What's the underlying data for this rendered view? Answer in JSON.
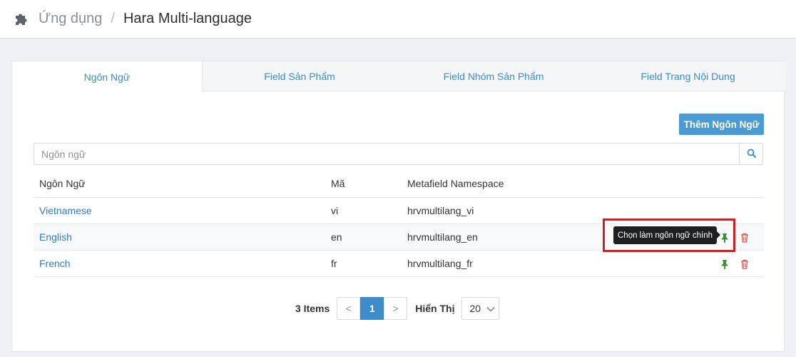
{
  "header": {
    "breadcrumb_parent": "Ứng dụng",
    "separator": "/",
    "title": "Hara Multi-language",
    "app_icon": "puzzle-icon"
  },
  "tabs": [
    {
      "label": "Ngôn Ngữ",
      "active": true
    },
    {
      "label": "Field Sản Phẩm",
      "active": false
    },
    {
      "label": "Field Nhóm Sản Phẩm",
      "active": false
    },
    {
      "label": "Field Trang Nội Dung",
      "active": false
    }
  ],
  "toolbar": {
    "add_label": "Thêm Ngôn Ngữ"
  },
  "search": {
    "placeholder": "Ngôn ngữ",
    "value": "",
    "icon": "search-icon"
  },
  "table": {
    "columns": [
      "Ngôn Ngữ",
      "Mã",
      "Metafield Namespace",
      ""
    ],
    "rows": [
      {
        "name": "Vietnamese",
        "code": "vi",
        "namespace": "hrvmultilang_vi",
        "actions": false
      },
      {
        "name": "English",
        "code": "en",
        "namespace": "hrvmultilang_en",
        "actions": true
      },
      {
        "name": "French",
        "code": "fr",
        "namespace": "hrvmultilang_fr",
        "actions": true
      }
    ]
  },
  "tooltip": {
    "text": "Chọn làm ngôn ngữ chính"
  },
  "pagination": {
    "items_text": "3 Items",
    "prev": "<",
    "current_page": "1",
    "next": ">",
    "show_label": "Hiển Thị",
    "per_page": "20"
  },
  "colors": {
    "accent": "#3b8cc9",
    "button": "#4a9ad4",
    "pin_green": "#3f8f3a",
    "trash_red": "#d9534f",
    "highlight_red": "#d0201f"
  }
}
